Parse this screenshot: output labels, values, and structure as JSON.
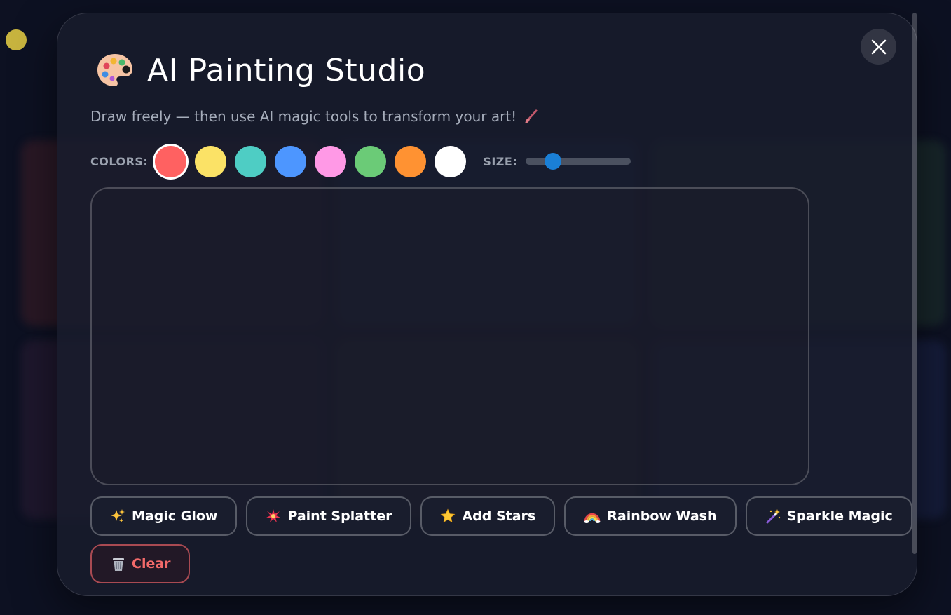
{
  "modal": {
    "title": "AI Painting Studio",
    "subtitle": "Draw freely — then use AI magic tools to transform your art!",
    "close_icon": "close-icon"
  },
  "toolbar": {
    "colors_label": "COLORS:",
    "size_label": "SIZE:",
    "colors": [
      "#ff6161",
      "#fbe266",
      "#4ecdc4",
      "#4d96ff",
      "#ff99e6",
      "#6bcb77",
      "#ff9232",
      "#ffffff"
    ],
    "selected_color_index": 0,
    "brush_size": 0.26
  },
  "tools": [
    {
      "label": "Magic Glow",
      "icon": "sparkles-icon"
    },
    {
      "label": "Paint Splatter",
      "icon": "burst-icon"
    },
    {
      "label": "Add Stars",
      "icon": "star-icon"
    },
    {
      "label": "Rainbow Wash",
      "icon": "rainbow-icon"
    },
    {
      "label": "Sparkle Magic",
      "icon": "magic-wand-icon"
    }
  ],
  "clear": {
    "label": "Clear",
    "icon": "trash-icon",
    "color": "#f26a6a"
  },
  "colors": {
    "accent": "#1a7fd6",
    "modal_bg": "#181c2c",
    "corner_dot": "#c8b43f"
  }
}
